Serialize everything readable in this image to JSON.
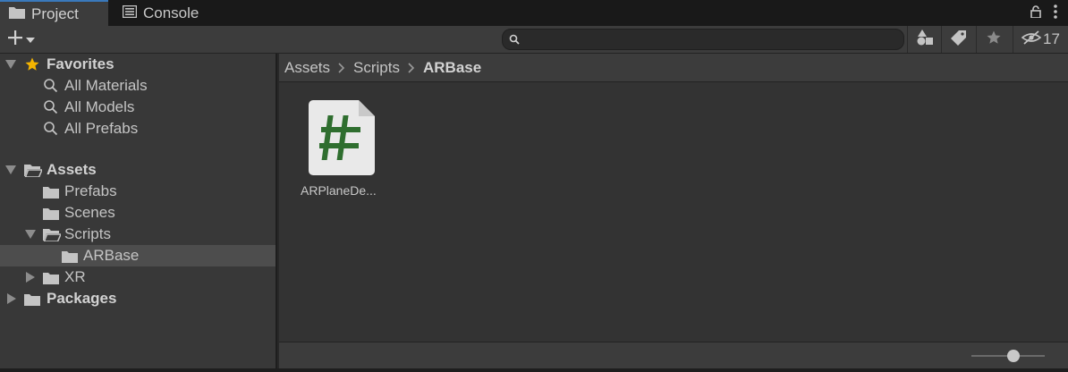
{
  "tabs": {
    "project": "Project",
    "console": "Console"
  },
  "toolbar": {
    "search_placeholder": "",
    "hidden_count": "17"
  },
  "tree": {
    "favorites": {
      "label": "Favorites",
      "items": [
        "All Materials",
        "All Models",
        "All Prefabs"
      ]
    },
    "assets": {
      "label": "Assets",
      "prefabs": "Prefabs",
      "scenes": "Scenes",
      "scripts": "Scripts",
      "arbase": "ARBase",
      "xr": "XR"
    },
    "packages": "Packages"
  },
  "breadcrumb": [
    "Assets",
    "Scripts",
    "ARBase"
  ],
  "assets": [
    {
      "name": "ARPlaneDe...",
      "icon": "csharp-script-icon"
    }
  ],
  "colors": {
    "accent": "#3a79bb",
    "script_hash": "#2f6e2f",
    "favorite_star": "#f4b400"
  }
}
